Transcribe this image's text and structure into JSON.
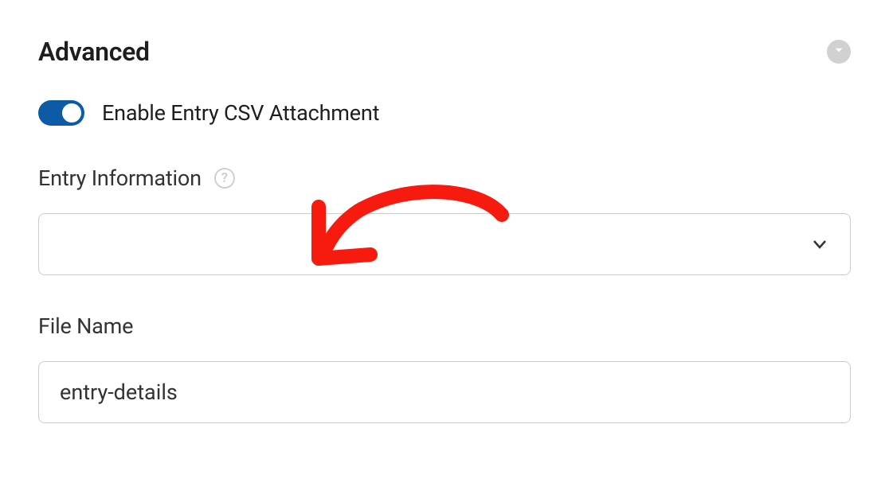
{
  "header": {
    "title": "Advanced"
  },
  "toggle": {
    "label": "Enable Entry CSV Attachment",
    "enabled": true
  },
  "entry_info": {
    "label": "Entry Information",
    "value": ""
  },
  "file_name": {
    "label": "File Name",
    "value": "entry-details"
  }
}
